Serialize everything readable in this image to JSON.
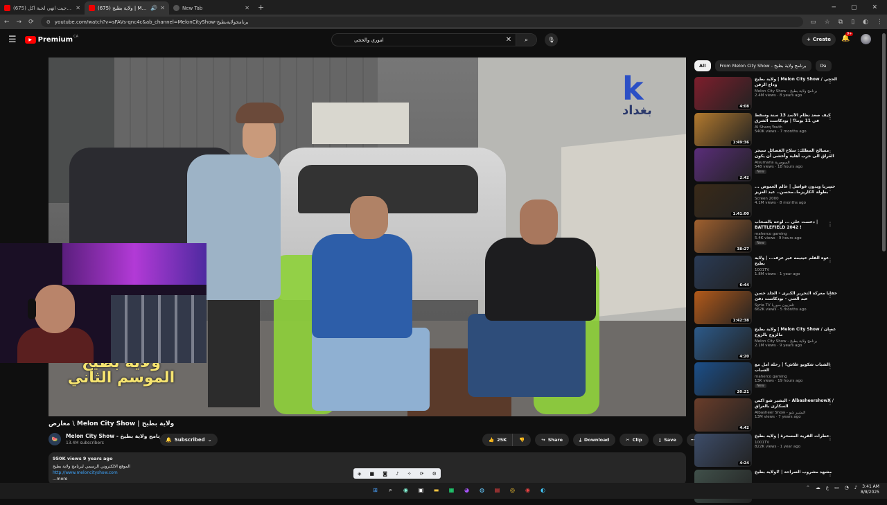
{
  "browser": {
    "tabs": [
      {
        "title": "(675) كود 11 جيت انهي لحبة اكل",
        "active": false
      },
      {
        "title": "(675) ولاية بطيخ | Melon City Show",
        "active": true
      },
      {
        "title": "New Tab",
        "active": false
      }
    ],
    "new_tab_glyph": "+",
    "url": "youtube.com/watch?v=sFAVs-qnc4c&ab_channel=MelonCityShow-برنامجولايةبطيخ"
  },
  "youtube": {
    "logo_text": "Premium",
    "country": "CA",
    "search_query": "اموري والحجي",
    "create_label": "Create",
    "notif_badge": "9+"
  },
  "video": {
    "watermark_logo": "k",
    "watermark_city": "بغداد",
    "caption_line1": "ولاية بطيخ",
    "caption_line2": "الموسم الثاني",
    "title": "معارض \\ Melon City Show | ولاية بطيخ",
    "channel_name": "Melon City Show - برنامج ولاية بطيخ",
    "subscribers": "13.4M subscribers",
    "subscribed_label": "Subscribed",
    "likes": "25K",
    "share_label": "Share",
    "download_label": "Download",
    "clip_label": "Clip",
    "save_label": "Save",
    "desc_stats": "950K views  9 years ago",
    "desc_line": "الموقع الالكتروني الرسمي لبرنامج ولاية بطيخ",
    "desc_link": "http://www.meloncityshow.com",
    "more_label": "...more"
  },
  "chips": [
    {
      "label": "All",
      "active": true
    },
    {
      "label": "From Melon City Show - برنامج ولاية بطيخ",
      "active": false
    },
    {
      "label": "Da",
      "active": false
    }
  ],
  "recs": [
    {
      "title": "ولاية بطيخ | Melon City Show / الحجي وداع الرفن",
      "channel": "Melon City Show - برنامج ولاية بطيخ",
      "meta": "2.4M views · 8 years ago",
      "dur": "4:08",
      "color": "#7e1e2c",
      "new": ""
    },
    {
      "title": "كيف صعد نظام الأسد 13 سنة وسقط في 11 يوما؟ | بودكاست الشرق",
      "channel": "Al Sharq Youth",
      "meta": "540K views · 7 months ago",
      "dur": "1:49:36",
      "color": "#b37a2e",
      "new": ""
    },
    {
      "title": "مسالح المطلك: سلاح الفصائل سيجر العراق الى حرب أهلية وأخشى أن يكون ...",
      "channel": "Alsumaria السومرية",
      "meta": "548 views · 18 hours ago",
      "dur": "2:42",
      "color": "#5a2d7a",
      "new": "New"
    },
    {
      "title": "حسريا ويدون فواصل | عالم الغموض ... بطولة #كاريزما..محسن.. عبد العزيز",
      "channel": "Screen 2000",
      "meta": "4.1M views · 8 months ago",
      "dur": "1:41:00",
      "color": "#3a2a18",
      "new": ""
    },
    {
      "title": "دعست على ... لوحة بالسحاب | BATTLEFIELD 2042 !",
      "channel": "mahercо gaming",
      "meta": "5.4K views · 9 hours ago",
      "dur": "38:27",
      "color": "#a0602e",
      "new": "New"
    },
    {
      "title": "عوه الفلم خيتيمه عير عزف... | ولاية بطيخ",
      "channel": "1001TV",
      "meta": "1.8M views · 1 year ago",
      "dur": "6:44",
      "color": "#2a3b56",
      "new": ""
    },
    {
      "title": "خفايا معركة التحرير الكبرى - الجلد حسن عبد الغني - بودكاست دفئ",
      "channel": "Syria TV تلفزيون سوريا",
      "meta": "662K views · 5 months ago",
      "dur": "1:42:38",
      "color": "#b35a1a",
      "new": ""
    },
    {
      "title": "ولاية بطيخ | Melon City Show / عصان مالزوع بالزوج",
      "channel": "Melon City Show - برنامج ولاية بطيخ",
      "meta": "2.1M views · 9 years ago",
      "dur": "4:20",
      "color": "#2c5a8a",
      "new": ""
    },
    {
      "title": "الشباب شكويو علاش؟ | رحلة أمل مع الشباب",
      "channel": "mahercо gaming",
      "meta": "13K views · 19 hours ago",
      "dur": "20:21",
      "color": "#1b4f8a",
      "new": "New"
    },
    {
      "title": "البشير شو اكس - AlbasheershowX / السكارى بالعراق",
      "channel": "Albasheer Show - البشير شو",
      "meta": "13M views · 7 years ago",
      "dur": "4:42",
      "color": "#6a3d2a",
      "new": ""
    },
    {
      "title": "خطرات القرية المسحرة | ولاية بطيخ",
      "channel": "1001TV",
      "meta": "822K views · 1 year ago",
      "dur": "4:24",
      "color": "#3d4d6a",
      "new": ""
    },
    {
      "title": "مشهد مشروب الصراحة | #ولاية بطيخ",
      "channel": "",
      "meta": "",
      "dur": "",
      "color": "#40504a",
      "new": ""
    }
  ],
  "taskbar": {
    "time": "3:41 AM",
    "date": "8/8/2025",
    "lang": "ع"
  }
}
